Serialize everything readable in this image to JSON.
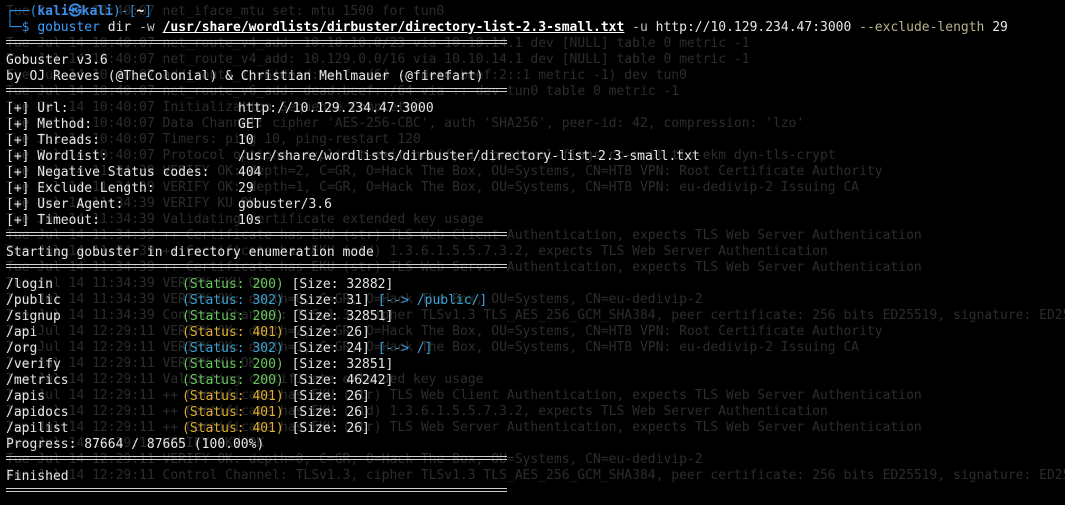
{
  "background_log": [
    "Tue Jul 14 10:40:07 net_iface_mtu set: mtu 1500 for tun0",
    "",
    "Tue Jul 14 10:40:07 net_route_v4_add: 10.10.10.0/23 via 10.10.14.1 dev [NULL] table 0 metric -1",
    "Tue Jul 14 10:40:07 net_route_v4_add: 10.129.0.0/16 via 10.10.14.1 dev [NULL] table 0 metric -1",
    "Tue Jul 14 10:40:07 add_route_ipv6(dead:beef::/64 -> dead:beef:2::1 metric -1) dev tun0",
    "Tue Jul 14 10:40:07 net_route_v6_add: dead:beef::/64 via :: dev tun0 table 0 metric -1",
    "Tue Jul 14 10:40:07 Initialization Sequence Completed",
    "Tue Jul 14 10:40:07 Data Channel: cipher 'AES-256-CBC', auth 'SHA256', peer-id: 42, compression: 'lzo'",
    "Tue Jul 14 10:40:07 Timers: ping 10, ping-restart 120",
    "Tue Jul 14 10:40:07 Protocol options: explicit-exit-notify 1, protocol-flags cc-exit tls-ekm dyn-tls-crypt",
    "Tue Jul 14 11:34:39 VERIFY OK: depth=2, C=GR, O=Hack The Box, OU=Systems, CN=HTB VPN: Root Certificate Authority",
    "Tue Jul 14 11:34:39 VERIFY OK: depth=1, C=GR, O=Hack The Box, OU=Systems, CN=HTB VPN: eu-dedivip-2 Issuing CA",
    "Tue Jul 14 11:34:39 VERIFY KU OK",
    "Tue Jul 14 11:34:39 Validating certificate extended key usage",
    "Tue Jul 14 11:34:39 ++ Certificate has EKU (str) TLS Web Client Authentication, expects TLS Web Server Authentication",
    "Tue Jul 14 11:34:39 ++ Certificate has EKU (oid) 1.3.6.1.5.5.7.3.2, expects TLS Web Server Authentication",
    "Tue Jul 14 11:34:39 ++ Certificate has EKU (str) TLS Web Server Authentication, expects TLS Web Server Authentication",
    "Tue Jul 14 11:34:39 VERIFY EKU OK",
    "Tue Jul 14 11:34:39 VERIFY OK: depth=0, C=GR, O=Hack The Box, OU=Systems, CN=eu-dedivip-2",
    "Tue Jul 14 11:34:39 Control Channel: TLSv1.3, cipher TLSv1.3 TLS_AES_256_GCM_SHA384, peer certificate: 256 bits ED25519, signature: ED25519",
    "Tue Jul 14 12:29:11 VERIFY OK: depth=2, C=GR, O=Hack The Box, OU=Systems, CN=HTB VPN: Root Certificate Authority",
    "Tue Jul 14 12:29:11 VERIFY OK: depth=1, C=GR, O=Hack The Box, OU=Systems, CN=HTB VPN: eu-dedivip-2 Issuing CA",
    "Tue Jul 14 12:29:11 VERIFY KU OK",
    "Tue Jul 14 12:29:11 Validating certificate extended key usage",
    "Tue Jul 14 12:29:11 ++ Certificate has EKU (str) TLS Web Client Authentication, expects TLS Web Server Authentication",
    "Tue Jul 14 12:29:11 ++ Certificate has EKU (oid) 1.3.6.1.5.5.7.3.2, expects TLS Web Server Authentication",
    "Tue Jul 14 12:29:11 ++ Certificate has EKU (str) TLS Web Server Authentication, expects TLS Web Server Authentication",
    "Tue Jul 14 12:29:11 VERIFY EKU OK",
    "Tue Jul 14 12:29:11 VERIFY OK: depth=0, C=GR, O=Hack The Box, OU=Systems, CN=eu-dedivip-2",
    "Tue Jul 14 12:29:11 Control Channel: TLSv1.3, cipher TLSv1.3 TLS_AES_256_GCM_SHA384, peer certificate: 256 bits ED25519, signature: ED25519"
  ],
  "prompt": {
    "line1_left": "┌──(",
    "user": "kali㉿kali",
    "mid": ")-[",
    "dir": "~",
    "line1_right": "]",
    "line2_prefix": "└─$ "
  },
  "command": {
    "name": "gobuster",
    "subcommand": " dir ",
    "wordlist_flag": "-w ",
    "wordlist": "/usr/share/wordlists/dirbuster/directory-list-2.3-small.txt",
    "url_flag": " -u ",
    "url": "http://10.129.234.47:3000",
    "exclude_flag": " --exclude-length",
    "exclude_value": " 29"
  },
  "banner": {
    "version": "Gobuster v3.6",
    "authors": "by OJ Reeves (@TheColonial) & Christian Mehlmauer (@firefart)"
  },
  "config": [
    {
      "key": "[+] Url:",
      "value": "http://10.129.234.47:3000"
    },
    {
      "key": "[+] Method:",
      "value": "GET"
    },
    {
      "key": "[+] Threads:",
      "value": "10"
    },
    {
      "key": "[+] Wordlist:",
      "value": "/usr/share/wordlists/dirbuster/directory-list-2.3-small.txt"
    },
    {
      "key": "[+] Negative Status codes:",
      "value": "404"
    },
    {
      "key": "[+] Exclude Length:",
      "value": "29"
    },
    {
      "key": "[+] User Agent:",
      "value": "gobuster/3.6"
    },
    {
      "key": "[+] Timeout:",
      "value": "10s"
    }
  ],
  "starting_message": "Starting gobuster in directory enumeration mode",
  "results": [
    {
      "path": "/login",
      "status": "(Status: 200)",
      "size": "[Size: 32882]",
      "redirect": "",
      "status_color": "#66c95a"
    },
    {
      "path": "/public",
      "status": "(Status: 302)",
      "size": "[Size: 31]",
      "redirect": "[--> /public/]",
      "status_color": "#3aa3d6"
    },
    {
      "path": "/signup",
      "status": "(Status: 200)",
      "size": "[Size: 32851]",
      "redirect": "",
      "status_color": "#66c95a"
    },
    {
      "path": "/api",
      "status": "(Status: 401)",
      "size": "[Size: 26]",
      "redirect": "",
      "status_color": "#e0b030"
    },
    {
      "path": "/org",
      "status": "(Status: 302)",
      "size": "[Size: 24]",
      "redirect": "[--> /]",
      "status_color": "#3aa3d6"
    },
    {
      "path": "/verify",
      "status": "(Status: 200)",
      "size": "[Size: 32851]",
      "redirect": "",
      "status_color": "#66c95a"
    },
    {
      "path": "/metrics",
      "status": "(Status: 200)",
      "size": "[Size: 46242]",
      "redirect": "",
      "status_color": "#66c95a"
    },
    {
      "path": "/apis",
      "status": "(Status: 401)",
      "size": "[Size: 26]",
      "redirect": "",
      "status_color": "#e0b030"
    },
    {
      "path": "/apidocs",
      "status": "(Status: 401)",
      "size": "[Size: 26]",
      "redirect": "",
      "status_color": "#e0b030"
    },
    {
      "path": "/apilist",
      "status": "(Status: 401)",
      "size": "[Size: 26]",
      "redirect": "",
      "status_color": "#e0b030"
    }
  ],
  "progress": "Progress: 87664 / 87665 (100.00%)",
  "finished": "Finished",
  "colors": {
    "background": "#000000",
    "foreground": "#e6e6e6",
    "status_200": "#66c95a",
    "status_302": "#3aa3d6",
    "status_401": "#e0b030",
    "prompt_blue": "#3b8eea"
  }
}
